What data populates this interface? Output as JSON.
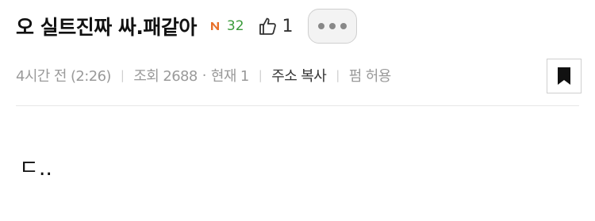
{
  "post": {
    "title": "오 실트진짜 싸.패같아",
    "comment_count": "32",
    "like_count": "1",
    "content": "ㄷ.."
  },
  "meta": {
    "time": "4시간 전 (2:26)",
    "views": "조회 2688",
    "current": "현재 1",
    "copy_link": "주소 복사",
    "repost": "펌 허용"
  },
  "icons": {
    "new_badge": "new-badge-icon",
    "like": "thumbs-up-icon",
    "more": "more-dots-icon",
    "bookmark": "bookmark-icon"
  },
  "colors": {
    "new_badge": "#e8702a",
    "comment_count": "#3a9a3a",
    "meta_text": "#9a9a9a"
  }
}
